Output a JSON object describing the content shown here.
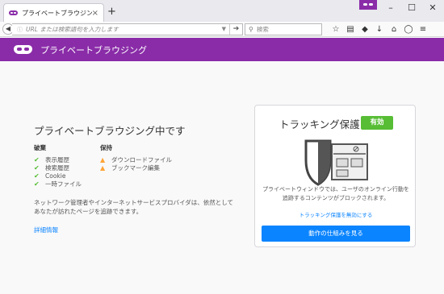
{
  "tab": {
    "title": "プライベートブラウジング中です",
    "close": "×",
    "new_tab": "+"
  },
  "window": {
    "minimize": "–",
    "maximize": "☐",
    "close": "✕"
  },
  "navbar": {
    "back": "◀",
    "url_info": "ⓘ",
    "url_placeholder": "URL または検索語句を入力します",
    "url_dropdown": "▼",
    "go": "➔",
    "search_placeholder": "検索",
    "search_icon": "search-icon",
    "bookmark_star": "☆",
    "reading_list": "▤",
    "pocket": "◆",
    "downloads": "↓",
    "home": "⌂",
    "sync": "◯",
    "menu": "≡"
  },
  "header": {
    "title": "プライベートブラウジング"
  },
  "main": {
    "title": "プライベートブラウジング中です",
    "discard": {
      "heading": "破棄",
      "items": [
        "表示履歴",
        "検索履歴",
        "Cookie",
        "一時ファイル"
      ]
    },
    "keep": {
      "heading": "保持",
      "items": [
        "ダウンロードファイル",
        "ブックマーク編集"
      ]
    },
    "description": "ネットワーク管理者やインターネットサービスプロバイダは、依然としてあなたが訪れたページを追跡できます。",
    "learn_more": "詳細情報"
  },
  "tracking": {
    "title": "トラッキング保護",
    "badge": "有効",
    "description": "プライベートウィンドウでは、ユーザのオンライン行動を追跡するコンテンツがブロックされます。",
    "disable_link": "トラッキング保護を無効にする",
    "button": "動作の仕組みを見る"
  },
  "colors": {
    "purple": "#8a2ca8",
    "green": "#57bd35",
    "blue": "#0a84ff",
    "warning": "#ffa436"
  }
}
